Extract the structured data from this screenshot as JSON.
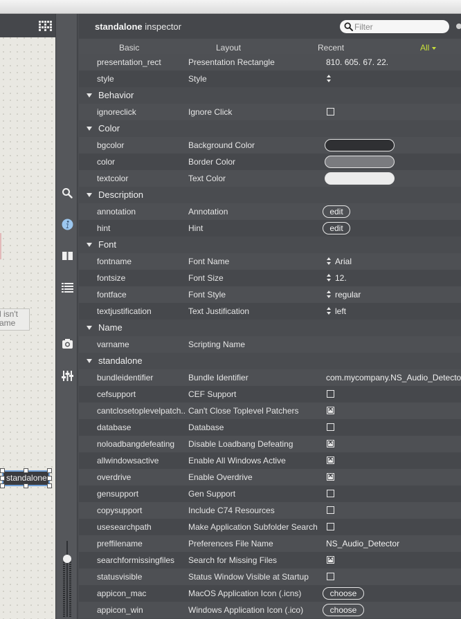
{
  "inspector": {
    "title_bold": "standalone",
    "title_rest": " inspector",
    "filter_placeholder": "Filter",
    "tabs": [
      {
        "label": "Basic",
        "active": false
      },
      {
        "label": "Layout",
        "active": false
      },
      {
        "label": "Recent",
        "active": false
      },
      {
        "label": "All",
        "active": true
      }
    ],
    "rows": [
      {
        "kind": "prop",
        "attr": "presentation_rect",
        "label": "Presentation Rectangle",
        "control": "text",
        "value": "810. 605. 67. 22."
      },
      {
        "kind": "prop",
        "attr": "style",
        "label": "Style",
        "control": "stepper",
        "value": ""
      },
      {
        "kind": "section",
        "name": "Behavior"
      },
      {
        "kind": "prop",
        "attr": "ignoreclick",
        "label": "Ignore Click",
        "control": "checkbox",
        "checked": false
      },
      {
        "kind": "section",
        "name": "Color"
      },
      {
        "kind": "prop",
        "attr": "bgcolor",
        "label": "Background Color",
        "control": "swatch",
        "color": "#2f3033"
      },
      {
        "kind": "prop",
        "attr": "color",
        "label": "Border Color",
        "control": "swatch",
        "color": "#7a7b7f"
      },
      {
        "kind": "prop",
        "attr": "textcolor",
        "label": "Text Color",
        "control": "swatch",
        "color": "#ececec"
      },
      {
        "kind": "section",
        "name": "Description"
      },
      {
        "kind": "prop",
        "attr": "annotation",
        "label": "Annotation",
        "control": "button",
        "value": "edit"
      },
      {
        "kind": "prop",
        "attr": "hint",
        "label": "Hint",
        "control": "button",
        "value": "edit"
      },
      {
        "kind": "section",
        "name": "Font"
      },
      {
        "kind": "prop",
        "attr": "fontname",
        "label": "Font Name",
        "control": "stepper",
        "value": "Arial"
      },
      {
        "kind": "prop",
        "attr": "fontsize",
        "label": "Font Size",
        "control": "stepper",
        "value": "12."
      },
      {
        "kind": "prop",
        "attr": "fontface",
        "label": "Font Style",
        "control": "stepper",
        "value": "regular"
      },
      {
        "kind": "prop",
        "attr": "textjustification",
        "label": "Text Justification",
        "control": "stepper",
        "value": "left"
      },
      {
        "kind": "section",
        "name": "Name"
      },
      {
        "kind": "prop",
        "attr": "varname",
        "label": "Scripting Name",
        "control": "text",
        "value": ""
      },
      {
        "kind": "section",
        "name": "standalone"
      },
      {
        "kind": "prop",
        "attr": "bundleidentifier",
        "label": "Bundle Identifier",
        "control": "text",
        "value": "com.mycompany.NS_Audio_Detector"
      },
      {
        "kind": "prop",
        "attr": "cefsupport",
        "label": "CEF Support",
        "control": "checkbox",
        "checked": false
      },
      {
        "kind": "prop",
        "attr": "cantclosetoplevelpatch...",
        "label": "Can't Close Toplevel Patchers",
        "control": "checkbox",
        "checked": true
      },
      {
        "kind": "prop",
        "attr": "database",
        "label": "Database",
        "control": "checkbox",
        "checked": false
      },
      {
        "kind": "prop",
        "attr": "noloadbangdefeating",
        "label": "Disable Loadbang Defeating",
        "control": "checkbox",
        "checked": true
      },
      {
        "kind": "prop",
        "attr": "allwindowsactive",
        "label": "Enable All Windows Active",
        "control": "checkbox",
        "checked": true
      },
      {
        "kind": "prop",
        "attr": "overdrive",
        "label": "Enable Overdrive",
        "control": "checkbox",
        "checked": true
      },
      {
        "kind": "prop",
        "attr": "gensupport",
        "label": "Gen Support",
        "control": "checkbox",
        "checked": false
      },
      {
        "kind": "prop",
        "attr": "copysupport",
        "label": "Include C74 Resources",
        "control": "checkbox",
        "checked": false
      },
      {
        "kind": "prop",
        "attr": "usesearchpath",
        "label": "Make Application Subfolder Search ...",
        "control": "checkbox",
        "checked": false
      },
      {
        "kind": "prop",
        "attr": "preffilename",
        "label": "Preferences File Name",
        "control": "text",
        "value": "NS_Audio_Detector"
      },
      {
        "kind": "prop",
        "attr": "searchformissingfiles",
        "label": "Search for Missing Files",
        "control": "checkbox",
        "checked": true
      },
      {
        "kind": "prop",
        "attr": "statusvisible",
        "label": "Status Window Visible at Startup",
        "control": "checkbox",
        "checked": false
      },
      {
        "kind": "prop",
        "attr": "appicon_mac",
        "label": "MacOS Application Icon (.icns)",
        "control": "button",
        "value": "choose"
      },
      {
        "kind": "prop",
        "attr": "appicon_win",
        "label": "Windows Application Icon (.ico)",
        "control": "button",
        "value": "choose"
      }
    ]
  },
  "canvas": {
    "comment_line1": "l isn't",
    "comment_line2": "ame",
    "object_label": "standalone"
  },
  "toolbar": {
    "icons": [
      "search-icon",
      "info-icon",
      "book-icon",
      "list-icon",
      "snapshot-icon",
      "mixer-icon"
    ]
  },
  "colors": {
    "accent": "#c8e03a",
    "selection": "#6fa0d8"
  }
}
